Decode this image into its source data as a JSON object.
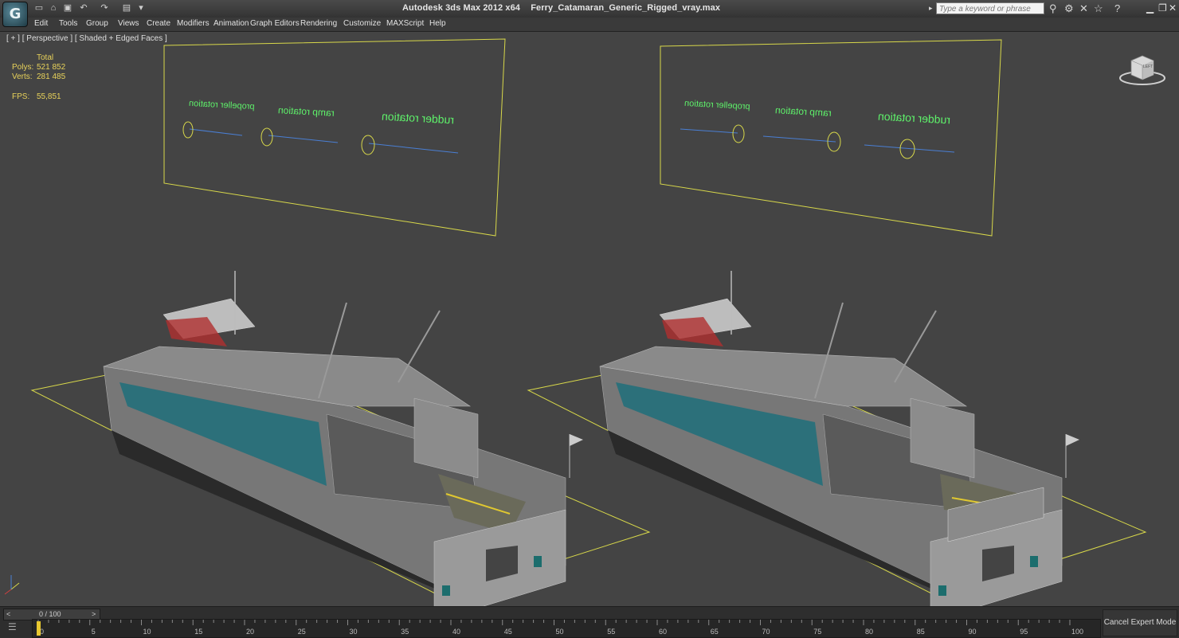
{
  "titlebar": {
    "app_name": "Autodesk 3ds Max  2012 x64",
    "file_name": "Ferry_Catamaran_Generic_Rigged_vray.max",
    "logo_glyph": "G",
    "search_placeholder": "Type a keyword or phrase",
    "quick_access_icons": [
      "new-file-icon",
      "open-file-icon",
      "save-icon",
      "undo-icon",
      "redo-icon",
      "project-folder-icon"
    ],
    "right_icons": [
      "binoculars-icon",
      "tools-icon",
      "star-icon",
      "help-icon"
    ]
  },
  "menu": [
    "Edit",
    "Tools",
    "Group",
    "Views",
    "Create",
    "Modifiers",
    "Animation",
    "Graph Editors",
    "Rendering",
    "Customize",
    "MAXScript",
    "Help"
  ],
  "viewport": {
    "label": "[ + ] [ Perspective ] [ Shaded + Edged Faces ]",
    "stats": {
      "total_label": "Total",
      "polys_label": "Polys:",
      "polys_value": "521 852",
      "verts_label": "Verts:",
      "verts_value": "281 485",
      "fps_label": "FPS:",
      "fps_value": "55,851"
    },
    "control_labels": {
      "left": [
        "propeller rotation",
        "ramp rotation",
        "rudder rotation"
      ],
      "right": [
        "propeller rotation",
        "ramp rotation",
        "rudder rotation"
      ]
    },
    "viewcube_label": "LEFT"
  },
  "timeline": {
    "frame_display": "0 / 100",
    "prev_arrow": "<",
    "next_arrow": ">",
    "ticks": [
      "0",
      "5",
      "10",
      "15",
      "20",
      "25",
      "30",
      "35",
      "40",
      "45",
      "50",
      "55",
      "60",
      "65",
      "70",
      "75",
      "80",
      "85",
      "90",
      "95",
      "100"
    ],
    "current_frame": 0,
    "total_frames": 100,
    "expert_button": "Cancel Expert Mode"
  },
  "colors": {
    "viewport_bg": "#444444",
    "selection_yellow": "#d8d84a",
    "label_green": "#5ef06a",
    "slider_blue": "#4a7fd4",
    "window_teal": "#2a7f8c"
  }
}
